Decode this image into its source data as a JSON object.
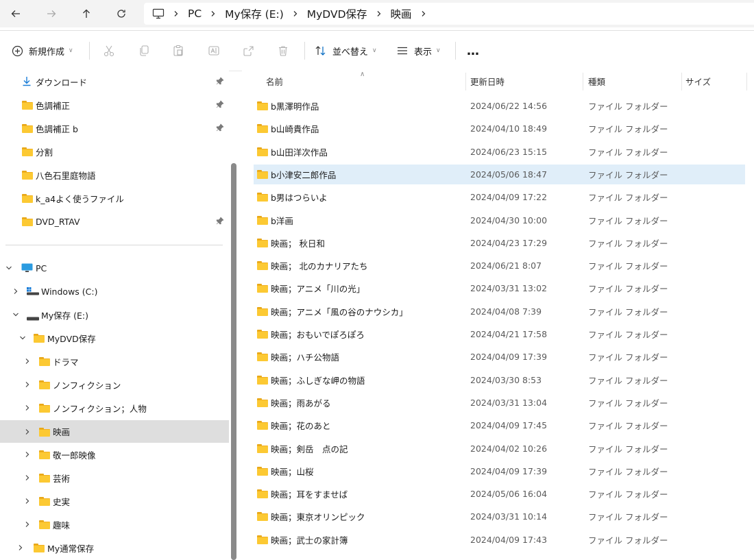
{
  "addressbar": {
    "breadcrumbs": [
      "PC",
      "My保存 (E:)",
      "MyDVD保存",
      "映画"
    ]
  },
  "commandbar": {
    "new_label": "新規作成",
    "sort_label": "並べ替え",
    "view_label": "表示",
    "more_label": "…"
  },
  "sidebar": {
    "quick_access": [
      {
        "label": "ダウンロード",
        "pinned": true
      },
      {
        "label": "色調補正",
        "pinned": true
      },
      {
        "label": "色調補正 b",
        "pinned": true
      },
      {
        "label": "分割",
        "pinned": false
      },
      {
        "label": "八色石里庭物語",
        "pinned": false
      },
      {
        "label": "k_a4よく使うファイル",
        "pinned": false
      },
      {
        "label": "DVD_RTAV",
        "pinned": true
      }
    ],
    "tree": {
      "pc": "PC",
      "windows": "Windows (C:)",
      "my_hozon": "My保存 (E:)",
      "mydvd": "MyDVD保存",
      "children": [
        "ドラマ",
        "ノンフィクション",
        "ノンフィクション；人物",
        "映画",
        "敬一郎映像",
        "芸術",
        "史実",
        "趣味"
      ],
      "my_tsujo": "My通常保存"
    }
  },
  "filelist": {
    "columns": {
      "name": "名前",
      "date": "更新日時",
      "type": "種類",
      "size": "サイズ"
    },
    "rows": [
      {
        "name": "b黒澤明作品",
        "date": "2024/06/22 14:56",
        "type": "ファイル フォルダー"
      },
      {
        "name": "b山崎貴作品",
        "date": "2024/04/10 18:49",
        "type": "ファイル フォルダー"
      },
      {
        "name": "b山田洋次作品",
        "date": "2024/06/23 15:15",
        "type": "ファイル フォルダー"
      },
      {
        "name": "b小津安二郎作品",
        "date": "2024/05/06 18:47",
        "type": "ファイル フォルダー"
      },
      {
        "name": "b男はつらいよ",
        "date": "2024/04/09 17:22",
        "type": "ファイル フォルダー"
      },
      {
        "name": "b洋画",
        "date": "2024/04/30 10:00",
        "type": "ファイル フォルダー"
      },
      {
        "name": "映画； 秋日和",
        "date": "2024/04/23 17:29",
        "type": "ファイル フォルダー"
      },
      {
        "name": "映画； 北のカナリアたち",
        "date": "2024/06/21 8:07",
        "type": "ファイル フォルダー"
      },
      {
        "name": "映画；アニメ「川の光」",
        "date": "2024/03/31 13:02",
        "type": "ファイル フォルダー"
      },
      {
        "name": "映画；アニメ「風の谷のナウシカ」",
        "date": "2024/04/08 7:39",
        "type": "ファイル フォルダー"
      },
      {
        "name": "映画；おもいでぽろぽろ",
        "date": "2024/04/21 17:58",
        "type": "ファイル フォルダー"
      },
      {
        "name": "映画；ハチ公物語",
        "date": "2024/04/09 17:39",
        "type": "ファイル フォルダー"
      },
      {
        "name": "映画；ふしぎな岬の物語",
        "date": "2024/03/30 8:53",
        "type": "ファイル フォルダー"
      },
      {
        "name": "映画；雨あがる",
        "date": "2024/03/31 13:04",
        "type": "ファイル フォルダー"
      },
      {
        "name": "映画；花のあと",
        "date": "2024/04/09 17:45",
        "type": "ファイル フォルダー"
      },
      {
        "name": "映画；剣岳　点の記",
        "date": "2024/04/02 10:26",
        "type": "ファイル フォルダー"
      },
      {
        "name": "映画；山桜",
        "date": "2024/04/09 17:39",
        "type": "ファイル フォルダー"
      },
      {
        "name": "映画；耳をすませば",
        "date": "2024/05/06 16:04",
        "type": "ファイル フォルダー"
      },
      {
        "name": "映画；東京オリンピック",
        "date": "2024/03/31 10:14",
        "type": "ファイル フォルダー"
      },
      {
        "name": "映画；武士の家計簿",
        "date": "2024/04/09 17:43",
        "type": "ファイル フォルダー"
      }
    ]
  },
  "colors": {
    "selected_row": "#e0eef9",
    "selected_nav": "#dedede",
    "folder": "#fcc933",
    "accent": "#0067c0"
  }
}
